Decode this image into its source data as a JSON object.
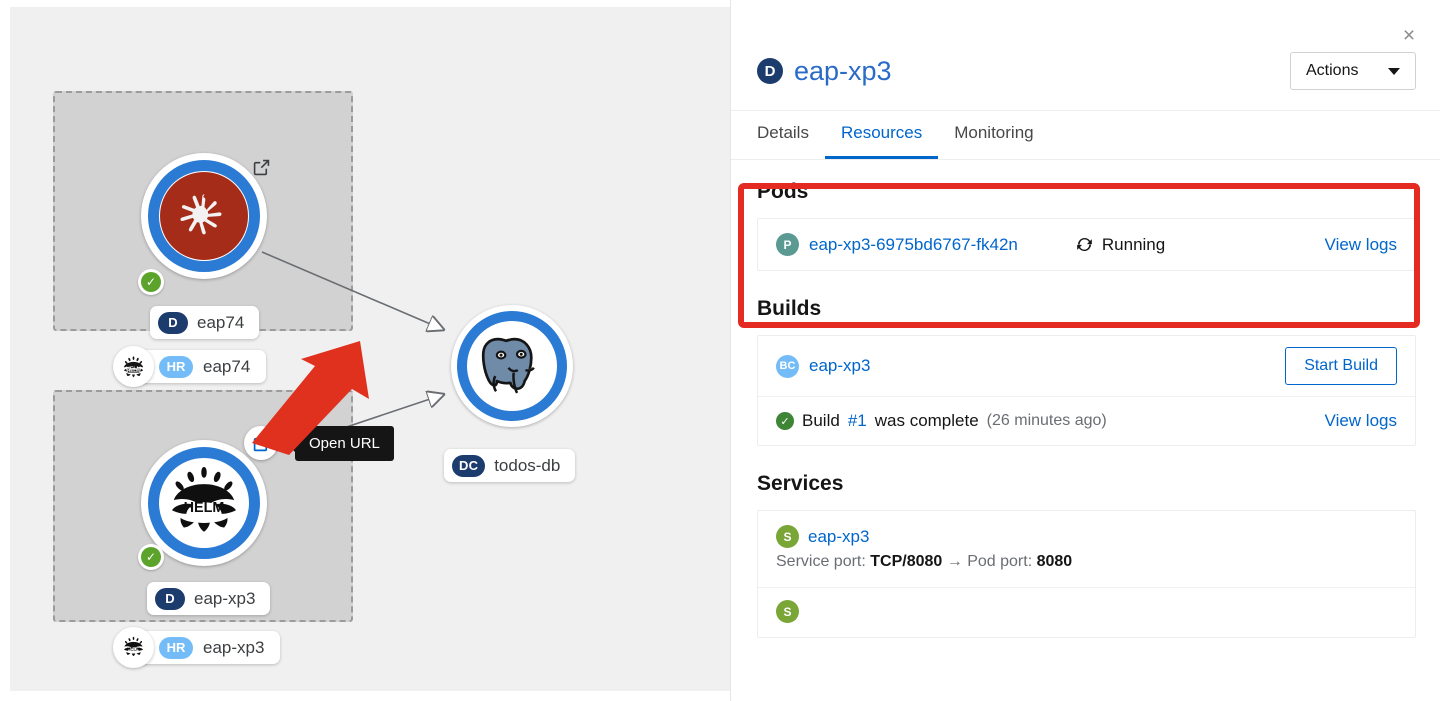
{
  "topology": {
    "nodes": [
      {
        "id": "eap74",
        "icon": "wildfly-dragonfly-icon",
        "status": "healthy",
        "kind_tag": "D",
        "label": "eap74",
        "helm_tag": "HR",
        "helm_label": "eap74",
        "open_url_label": "Open URL"
      },
      {
        "id": "eap-xp3",
        "icon": "helm-icon",
        "status": "healthy",
        "kind_tag": "D",
        "label": "eap-xp3",
        "helm_tag": "HR",
        "helm_label": "eap-xp3",
        "open_url_label": "Open URL"
      },
      {
        "id": "todos-db",
        "icon": "postgresql-elephant-icon",
        "kind_tag": "DC",
        "label": "todos-db"
      }
    ],
    "tooltip": "Open URL"
  },
  "panel": {
    "close_label": "×",
    "title": "eap-xp3",
    "title_badge": "D",
    "actions_label": "Actions",
    "tabs": [
      {
        "label": "Details",
        "active": false
      },
      {
        "label": "Resources",
        "active": true
      },
      {
        "label": "Monitoring",
        "active": false
      }
    ],
    "pods": {
      "heading": "Pods",
      "rows": [
        {
          "badge": "P",
          "name": "eap-xp3-6975bd6767-fk42n",
          "status": "Running",
          "status_icon": "sync-icon",
          "action": "View logs"
        }
      ]
    },
    "builds": {
      "heading": "Builds",
      "config": {
        "badge": "BC",
        "name": "eap-xp3",
        "button": "Start Build"
      },
      "latest": {
        "prefix": "Build ",
        "number": "#1",
        "suffix": " was complete ",
        "time": "(26 minutes ago)",
        "action": "View logs"
      }
    },
    "services": {
      "heading": "Services",
      "rows": [
        {
          "badge": "S",
          "name": "eap-xp3",
          "port_label": "Service port: ",
          "port_value": "TCP/8080",
          "arrow": "→",
          "pod_port_label": " Pod port: ",
          "pod_port_value": "8080"
        }
      ]
    }
  },
  "colors": {
    "accent_blue": "#0066cc",
    "title_blue": "#2a6bc8",
    "highlight_red": "#e32b22",
    "status_green": "#3e8635",
    "node_ring_blue": "#2b7bd4",
    "wildfly_red": "#a52c19",
    "tag_navy": "#1d3c6e",
    "tag_lightblue": "#73bcf7"
  }
}
